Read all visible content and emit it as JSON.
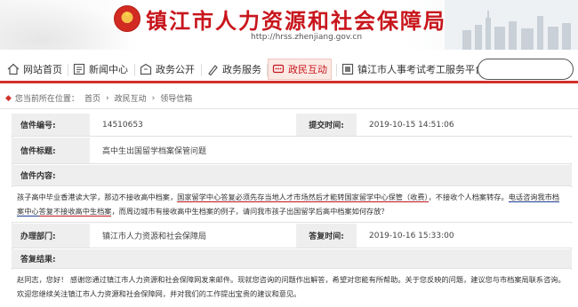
{
  "header": {
    "title": "镇江市人力资源和社会保障局",
    "url": "http://hrss.zhenjiang.gov.cn"
  },
  "nav": {
    "items": [
      {
        "label": "网站首页",
        "icon": "home-icon"
      },
      {
        "label": "新闻中心",
        "icon": "news-icon"
      },
      {
        "label": "政务公开",
        "icon": "government-icon"
      },
      {
        "label": "政务服务",
        "icon": "service-icon"
      },
      {
        "label": "政民互动",
        "icon": "chat-icon",
        "active": true
      },
      {
        "label": "镇江市人事考试考工服务平台",
        "icon": "exam-icon"
      }
    ]
  },
  "breadcrumb": {
    "prefix": "您当前所在位置：",
    "items": [
      "首页",
      "政民互动",
      "领导信箱"
    ],
    "sep": "›"
  },
  "letter": {
    "number_label": "信件编号:",
    "number": "14510653",
    "submit_time_label": "提交时间:",
    "submit_time": "2019-10-15 14:51:06",
    "subject_label": "信件标题:",
    "subject": "高中生出国留学档案保管问题",
    "content_label": "信件内容:",
    "content_parts": [
      {
        "text": "孩子高中毕业香港读大学，那边不接收高中档案，",
        "mark": ""
      },
      {
        "text": "国家留学中心答复必须先存当地人才市场然后才能转国家留学中心保管（收费）",
        "mark": "red"
      },
      {
        "text": "，不接收个人档案转存。",
        "mark": ""
      },
      {
        "text": "电话咨询我市档案中心",
        "mark": "blue"
      },
      {
        "text": "答复不接收高中生档案",
        "mark": "red"
      },
      {
        "text": "，而周边城市有接收高中生档案的例子，请问我市孩子出国留学后高中档案如何存放？",
        "mark": ""
      }
    ],
    "dept_label": "办理部门:",
    "dept": "镇江市人力资源和社会保障局",
    "reply_time_label": "答复时间:",
    "reply_time": "2019-10-16 15:33:00",
    "reply_label": "答复结果:",
    "reply": "赵同志，您好！ 感谢您通过镇江市人力资源和社会保障网发来邮件。现就您咨询的问题作出解答，希望对您能有所帮助。关于您反映的问题，建议您与市档案局联系咨询。 欢迎您继续关注镇江市人力资源和社会保障网，并对我们的工作提出宝贵的建议和意见。"
  },
  "colors": {
    "brand_red": "#c8161d",
    "nav_border": "#d2302a",
    "label_bg": "#eeeeee"
  }
}
